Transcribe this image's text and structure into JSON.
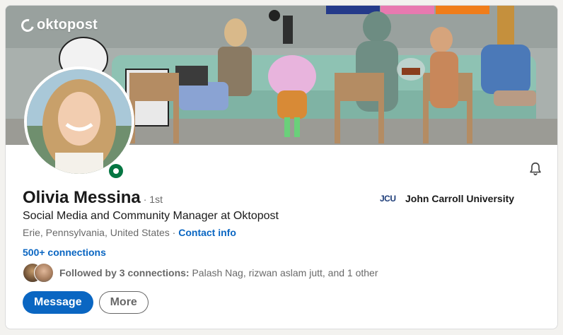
{
  "banner": {
    "brand": "oktopost"
  },
  "profile": {
    "name": "Olivia Messina",
    "degree": "· 1st",
    "headline": "Social Media and Community Manager at Oktopost",
    "location": "Erie, Pennsylvania, United States",
    "separator": " · ",
    "contact_info": "Contact info",
    "connections": "500+ connections",
    "followed_label": "Followed by 3 connections:",
    "followed_names": " Palash Nag, rizwan aslam jutt, and 1 other"
  },
  "education": {
    "logo_text": "JCU",
    "school": "John Carroll University"
  },
  "actions": {
    "message": "Message",
    "more": "More"
  },
  "icons": {
    "bell": "bell-icon",
    "status": "online-status-icon"
  },
  "colors": {
    "primary": "#0a66c2",
    "online": "#057642"
  }
}
